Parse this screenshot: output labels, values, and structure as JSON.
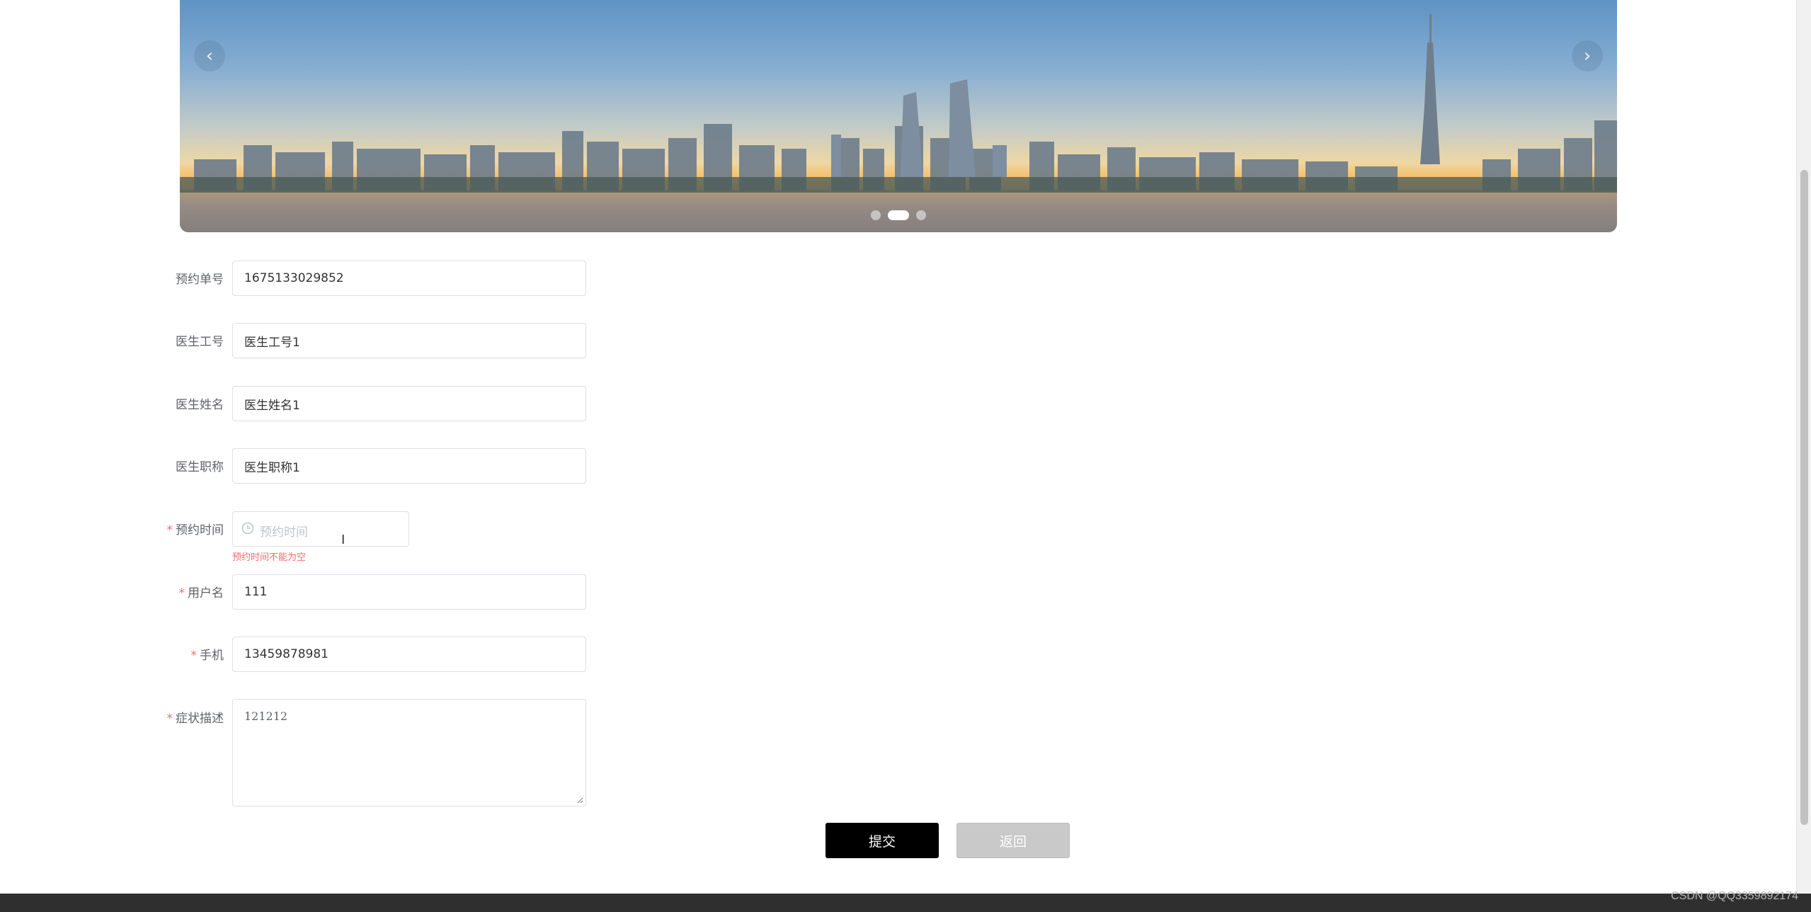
{
  "carousel": {
    "prev_icon": "‹",
    "next_icon": "›",
    "slides_count": 3,
    "active_index": 1
  },
  "form": {
    "order_no": {
      "label": "预约单号",
      "value": "1675133029852",
      "required": false
    },
    "doctor_id": {
      "label": "医生工号",
      "value": "医生工号1",
      "required": false
    },
    "doctor_name": {
      "label": "医生姓名",
      "value": "医生姓名1",
      "required": false
    },
    "doctor_title": {
      "label": "医生职称",
      "value": "医生职称1",
      "required": false
    },
    "appointment_time": {
      "label": "预约时间",
      "placeholder": "预约时间",
      "error": "预约时间不能为空",
      "required": true
    },
    "username": {
      "label": "用户名",
      "value": "111",
      "required": true
    },
    "phone": {
      "label": "手机",
      "value": "13459878981",
      "required": true
    },
    "symptoms": {
      "label": "症状描述",
      "value": "121212",
      "required": true
    },
    "required_mark": "*"
  },
  "buttons": {
    "submit": "提交",
    "back": "返回"
  },
  "watermark": "CSDN @QQ3359892174",
  "colors": {
    "error": "#f56c6c",
    "submit_bg": "#000000",
    "back_bg": "#c9c9c9"
  }
}
